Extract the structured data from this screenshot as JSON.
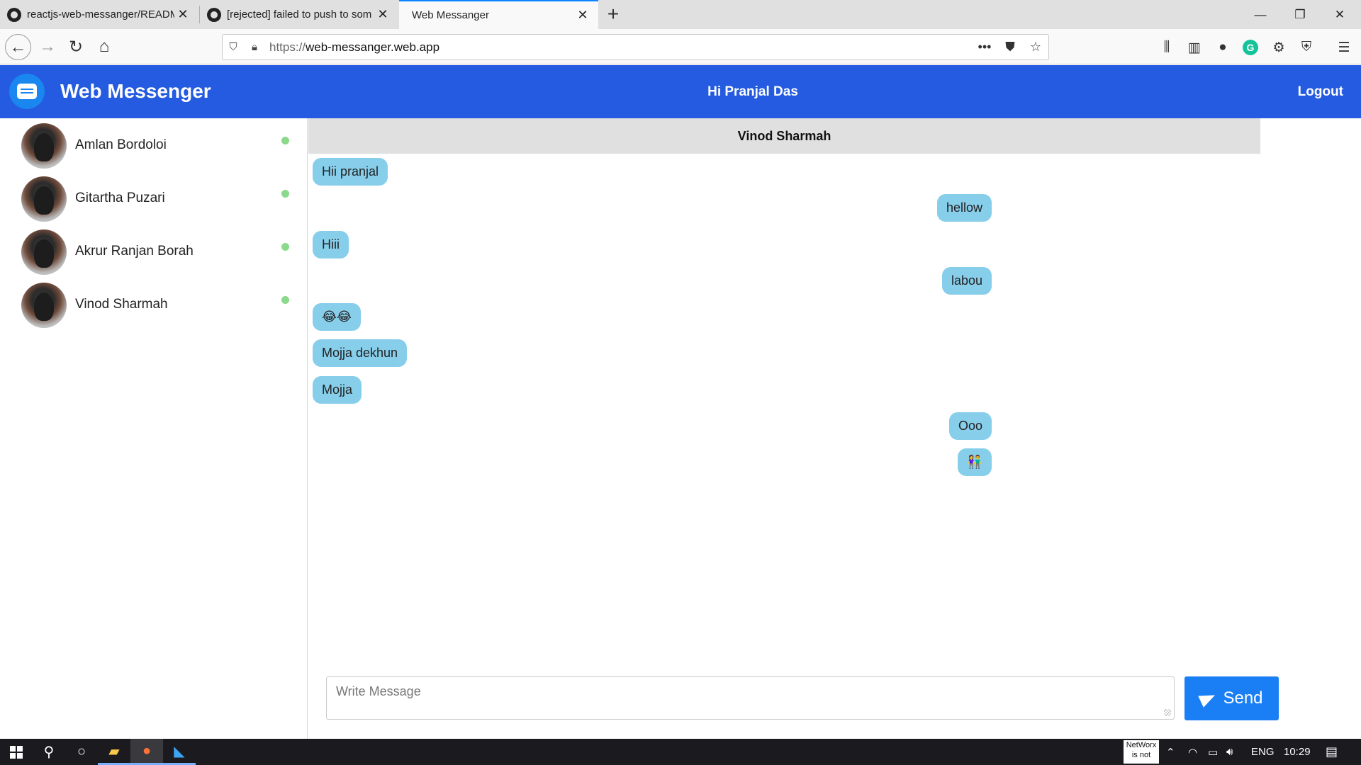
{
  "browser": {
    "tabs": [
      {
        "title": "reactjs-web-messanger/README",
        "icon": "github-icon"
      },
      {
        "title": "[rejected] failed to push to som",
        "icon": "github-icon"
      },
      {
        "title": "Web Messanger",
        "icon": ""
      }
    ],
    "new_tab": "+",
    "url_scheme": "https://",
    "url_host": "web-messanger.web.app",
    "window_controls": {
      "minimize": "—",
      "restore": "❐",
      "close": "✕"
    }
  },
  "app": {
    "brand": "Web Messenger",
    "greeting": "Hi Pranjal Das",
    "logout": "Logout",
    "accent": "#245be0"
  },
  "contacts": [
    {
      "name": "Amlan Bordoloi",
      "online": true
    },
    {
      "name": "Gitartha Puzari",
      "online": true
    },
    {
      "name": "Akrur Ranjan Borah",
      "online": true
    },
    {
      "name": "Vinod Sharmah",
      "online": true
    }
  ],
  "chat": {
    "title": "Vinod Sharmah",
    "messages": [
      {
        "text": "Hii pranjal",
        "side": "left"
      },
      {
        "text": "hellow",
        "side": "right"
      },
      {
        "text": "Hiii",
        "side": "left"
      },
      {
        "text": "labou",
        "side": "right"
      },
      {
        "text": "😂😂",
        "side": "left"
      },
      {
        "text": "Mojja dekhun",
        "side": "left"
      },
      {
        "text": "Mojja",
        "side": "left"
      },
      {
        "text": "Ooo",
        "side": "right"
      },
      {
        "text": "👫",
        "side": "right"
      }
    ],
    "composer_placeholder": "Write Message",
    "send_label": "Send"
  },
  "taskbar": {
    "networx_line1": "NetWorx",
    "networx_line2": "is not",
    "language": "ENG",
    "time": "10:29"
  }
}
